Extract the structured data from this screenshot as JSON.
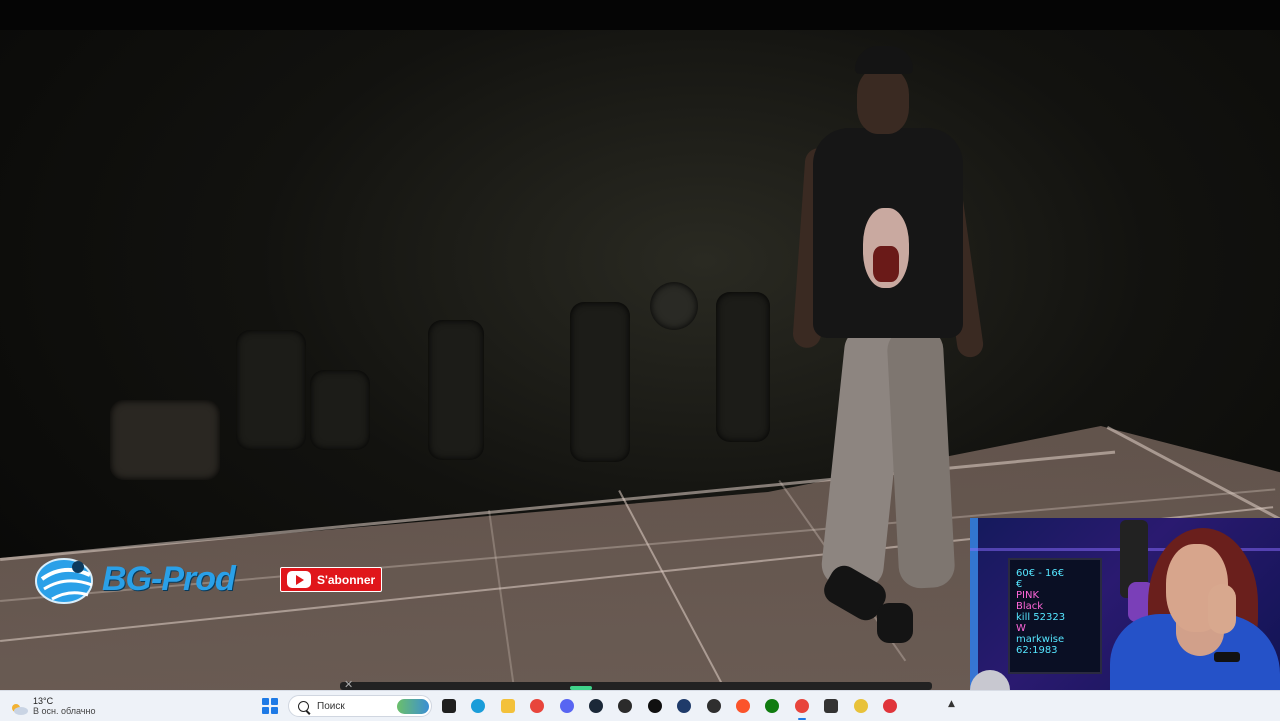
{
  "video": {
    "watermark": {
      "brand": "BG-Prod",
      "subscribe_label": "S'abonner"
    }
  },
  "webcam": {
    "board_lines": [
      "60€ - 16€",
      "€",
      "PINK",
      "Black",
      "kill 52323",
      "W",
      "markwise",
      "62:1983"
    ]
  },
  "taskbar": {
    "weather": {
      "temperature": "13°C",
      "description": "В осн. облачно",
      "icon": "partly-cloudy-icon"
    },
    "search": {
      "placeholder": "Поиск"
    },
    "apps": [
      {
        "name": "task-view-icon",
        "color": "#1f1f1f"
      },
      {
        "name": "edge-icon",
        "color": "#1a9dd9"
      },
      {
        "name": "file-explorer-icon",
        "color": "#f3c13a"
      },
      {
        "name": "chrome-icon",
        "color": "#e8453c"
      },
      {
        "name": "discord-icon",
        "color": "#5865f2"
      },
      {
        "name": "steam-icon",
        "color": "#1b2838"
      },
      {
        "name": "game-launcher-icon",
        "color": "#2b2b2b"
      },
      {
        "name": "chatgpt-icon",
        "color": "#101010"
      },
      {
        "name": "app-c-icon",
        "color": "#1f3b6a"
      },
      {
        "name": "obs-icon",
        "color": "#2f2f2f"
      },
      {
        "name": "brave-icon",
        "color": "#fb542b"
      },
      {
        "name": "xbox-icon",
        "color": "#107c10"
      },
      {
        "name": "chrome-active-icon",
        "color": "#e8453c"
      },
      {
        "name": "phone-icon",
        "color": "#333333"
      },
      {
        "name": "streamer-app-icon",
        "color": "#e8c23a"
      },
      {
        "name": "red-app-icon",
        "color": "#e0353b"
      }
    ]
  }
}
